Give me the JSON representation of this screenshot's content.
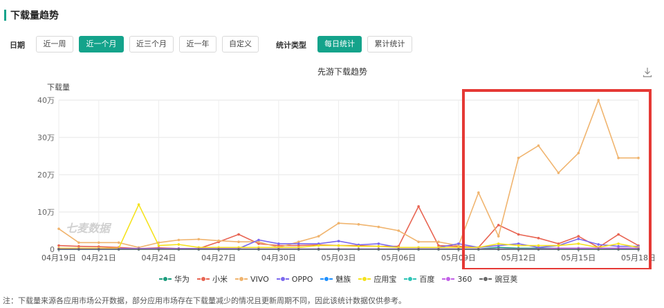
{
  "section_title": "下载量趋势",
  "filters": {
    "date_label": "日期",
    "date_options": [
      "近一周",
      "近一个月",
      "近三个月",
      "近一年",
      "自定义"
    ],
    "date_active": 1,
    "stat_label": "统计类型",
    "stat_options": [
      "每日统计",
      "累计统计"
    ],
    "stat_active": 0
  },
  "colors": {
    "accent": "#14a38b",
    "highlight_box": "#e53935"
  },
  "icons": {
    "download": "download-icon"
  },
  "chart_data": {
    "type": "line",
    "title": "先游下载趋势",
    "ylabel": "下载量",
    "watermark": "七麦数据",
    "ylim": [
      0,
      40
    ],
    "y_ticks": [
      "0",
      "10万",
      "20万",
      "30万",
      "40万"
    ],
    "x": [
      "04月19日",
      "04月20日",
      "04月21日",
      "04月22日",
      "04月23日",
      "04月24日",
      "04月25日",
      "04月26日",
      "04月27日",
      "04月28日",
      "04月29日",
      "04月30日",
      "05月01日",
      "05月02日",
      "05月03日",
      "05月04日",
      "05月05日",
      "05月06日",
      "05月07日",
      "05月08日",
      "05月09日",
      "05月10日",
      "05月11日",
      "05月12日",
      "05月13日",
      "05月14日",
      "05月15日",
      "05月16日",
      "05月17日",
      "05月18日"
    ],
    "x_tick_labels": [
      "04月19日",
      "04月21日",
      "04月24日",
      "04月27日",
      "04月30日",
      "05月03日",
      "05月06日",
      "05月09日",
      "05月12日",
      "05月15日",
      "05月18日"
    ],
    "series": [
      {
        "name": "华为",
        "color": "#1a9c7c",
        "values": [
          0.1,
          0.1,
          0.1,
          0.1,
          0.1,
          0.3,
          0.2,
          0.2,
          0.1,
          0.1,
          0.1,
          0.1,
          0.1,
          0.1,
          0.1,
          0.1,
          0.1,
          0.1,
          0.1,
          0.1,
          0.1,
          0.1,
          0.5,
          0.3,
          0.3,
          0.3,
          0.3,
          0.3,
          0.3,
          0.3
        ]
      },
      {
        "name": "小米",
        "color": "#e86452",
        "values": [
          1.0,
          0.8,
          0.7,
          0.5,
          0.2,
          0.4,
          0.2,
          0.2,
          2.0,
          4.0,
          1.5,
          1.0,
          1.0,
          1.2,
          1.0,
          1.0,
          0.8,
          0.8,
          11.5,
          1.0,
          0.8,
          0.5,
          6.5,
          4.0,
          3.0,
          1.5,
          3.5,
          0.5,
          4.0,
          1.0
        ]
      },
      {
        "name": "VIVO",
        "color": "#f0b46e",
        "values": [
          5.5,
          1.8,
          1.8,
          1.8,
          0.5,
          1.8,
          2.5,
          2.7,
          2.3,
          2.0,
          2.0,
          0.5,
          2.0,
          3.5,
          7.0,
          6.7,
          6.0,
          5.0,
          2.0,
          2.0,
          1.0,
          15.2,
          3.5,
          24.5,
          27.8,
          20.5,
          25.8,
          40.0,
          24.5,
          24.5
        ]
      },
      {
        "name": "OPPO",
        "color": "#7b68ee",
        "values": [
          0.2,
          0.2,
          0.2,
          0.2,
          0.2,
          0.2,
          0.2,
          0.2,
          0.2,
          0.2,
          2.5,
          1.5,
          1.5,
          1.5,
          2.2,
          1.2,
          1.5,
          0.5,
          0.5,
          0.5,
          1.5,
          0.5,
          1.0,
          1.5,
          0.5,
          1.0,
          2.8,
          1.3,
          0.8,
          0.8
        ]
      },
      {
        "name": "魅族",
        "color": "#1e90ff",
        "values": [
          0,
          0,
          0,
          0,
          0,
          0.1,
          0,
          0,
          0,
          0,
          0,
          0,
          0,
          0,
          0,
          0,
          0,
          0,
          0,
          0,
          0,
          0,
          0,
          0,
          0,
          0,
          0,
          0,
          0,
          0
        ]
      },
      {
        "name": "应用宝",
        "color": "#f5e21c",
        "values": [
          0.3,
          0.3,
          0.3,
          0.3,
          12.0,
          1.0,
          1.3,
          0.5,
          0.5,
          0.5,
          0.5,
          0.5,
          0.5,
          1.0,
          1.0,
          0.8,
          0.8,
          0.5,
          0.5,
          0.5,
          0.5,
          0.5,
          1.5,
          1.0,
          1.0,
          1.0,
          1.5,
          0.5,
          1.5,
          0.5
        ]
      },
      {
        "name": "百度",
        "color": "#2ec4b6",
        "values": [
          0,
          0,
          0,
          0,
          0,
          0,
          0,
          0,
          0,
          0,
          0,
          0,
          0,
          0,
          0,
          0,
          0,
          0,
          0,
          0,
          0,
          0,
          0,
          0,
          0,
          0,
          0,
          0,
          0,
          0
        ]
      },
      {
        "name": "360",
        "color": "#c25fe8",
        "values": [
          0.1,
          0.1,
          0.1,
          0.1,
          0.1,
          0.1,
          0.1,
          0.1,
          0.1,
          0.1,
          0.1,
          0.1,
          0.1,
          0.1,
          0.1,
          0.1,
          0.1,
          0.1,
          0.1,
          0.1,
          0.1,
          0.1,
          0.1,
          0.1,
          0.1,
          0.3,
          0.3,
          0.3,
          0.3,
          0.3
        ]
      },
      {
        "name": "豌豆荚",
        "color": "#666666",
        "values": [
          0,
          0,
          0,
          0,
          0,
          0,
          0,
          0,
          0,
          0,
          0,
          0,
          0,
          0,
          0,
          0,
          0,
          0,
          0,
          0,
          0,
          0,
          0,
          0,
          0,
          0,
          0,
          0,
          0,
          0
        ]
      }
    ]
  },
  "note": "注：下载量来源各应用市场公开数据，部分应用市场存在下载量减少的情况且更新周期不同，因此该统计数据仅供参考。"
}
